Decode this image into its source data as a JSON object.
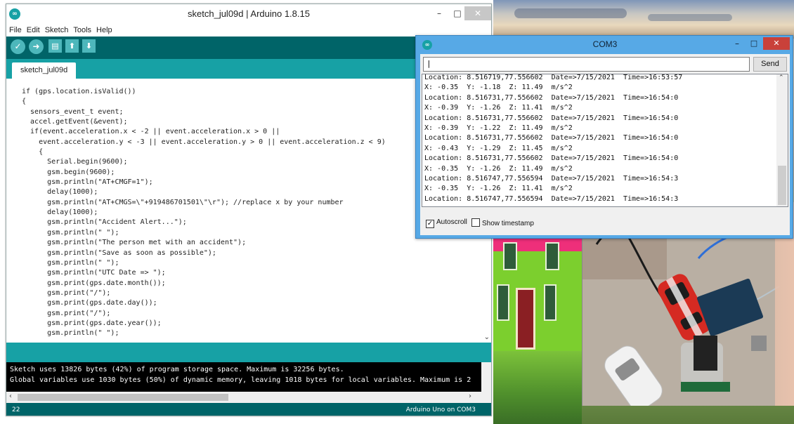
{
  "ide": {
    "title": "sketch_jul09d | Arduino 1.8.15",
    "logo_glyph": "∞",
    "window_controls": {
      "minimize": "–",
      "maximize": "□",
      "close": "✕"
    },
    "menu": [
      "File",
      "Edit",
      "Sketch",
      "Tools",
      "Help"
    ],
    "toolbar": {
      "verify": "✓",
      "upload": "➜",
      "new": "▤",
      "open": "⬆",
      "save": "⬇"
    },
    "tab_label": "sketch_jul09d",
    "code_lines": [
      "if (gps.location.isValid())",
      "{",
      "  sensors_event_t event;",
      "  accel.getEvent(&event);",
      "  if(event.acceleration.x < -2 || event.acceleration.x > 0 ||",
      "    event.acceleration.y < -3 || event.acceleration.y > 0 || event.acceleration.z < 9)",
      "    {",
      "      Serial.begin(9600);",
      "      gsm.begin(9600);",
      "      gsm.println(\"AT+CMGF=1\");",
      "      delay(1000);",
      "      gsm.println(\"AT+CMGS=\\\"+919486701501\\\"\\r\"); //replace x by your number",
      "      delay(1000);",
      "      gsm.println(\"Accident Alert...\");",
      "      gsm.println(\" \");",
      "      gsm.println(\"The person met with an accident\");",
      "      gsm.println(\"Save as soon as possible\");",
      "      gsm.println(\" \");",
      "      gsm.println(\"UTC Date => \");",
      "      gsm.print(gps.date.month());",
      "      gsm.print(\"/\");",
      "      gsm.print(gps.date.day());",
      "      gsm.print(\"/\");",
      "      gsm.print(gps.date.year());",
      "      gsm.println(\" \");"
    ],
    "console_lines": [
      "Sketch uses 13826 bytes (42%) of program storage space. Maximum is 32256 bytes.",
      "Global variables use 1030 bytes (50%) of dynamic memory, leaving 1018 bytes for local variables. Maximum is 2"
    ],
    "status_line": "22",
    "board": "Arduino Uno on COM3"
  },
  "serial": {
    "title": "COM3",
    "window_controls": {
      "minimize": "–",
      "maximize": "□",
      "close": "✕"
    },
    "input_value": "|",
    "send_label": "Send",
    "output_lines": [
      "Location: 8.516719,77.556602  Date=>7/15/2021  Time=>16:53:57",
      "X: -0.35  Y: -1.18  Z: 11.49  m/s^2",
      "Location: 8.516731,77.556602  Date=>7/15/2021  Time=>16:54:0",
      "X: -0.39  Y: -1.26  Z: 11.41  m/s^2",
      "Location: 8.516731,77.556602  Date=>7/15/2021  Time=>16:54:0",
      "X: -0.39  Y: -1.22  Z: 11.49  m/s^2",
      "Location: 8.516731,77.556602  Date=>7/15/2021  Time=>16:54:0",
      "X: -0.43  Y: -1.29  Z: 11.45  m/s^2",
      "Location: 8.516731,77.556602  Date=>7/15/2021  Time=>16:54:0",
      "X: -0.35  Y: -1.26  Z: 11.49  m/s^2",
      "Location: 8.516747,77.556594  Date=>7/15/2021  Time=>16:54:3",
      "X: -0.35  Y: -1.26  Z: 11.41  m/s^2",
      "Location: 8.516747,77.556594  Date=>7/15/2021  Time=>16:54:3"
    ],
    "autoscroll_label": "Autoscroll",
    "autoscroll_checked": true,
    "timestamp_label": "Show timestamp",
    "timestamp_checked": false
  },
  "colors": {
    "toolbar_dark_teal": "#006468",
    "tab_teal": "#17a1a5",
    "button_teal": "#4db7bb",
    "serial_frame_blue": "#57a9e6",
    "close_red": "#c9413a"
  }
}
